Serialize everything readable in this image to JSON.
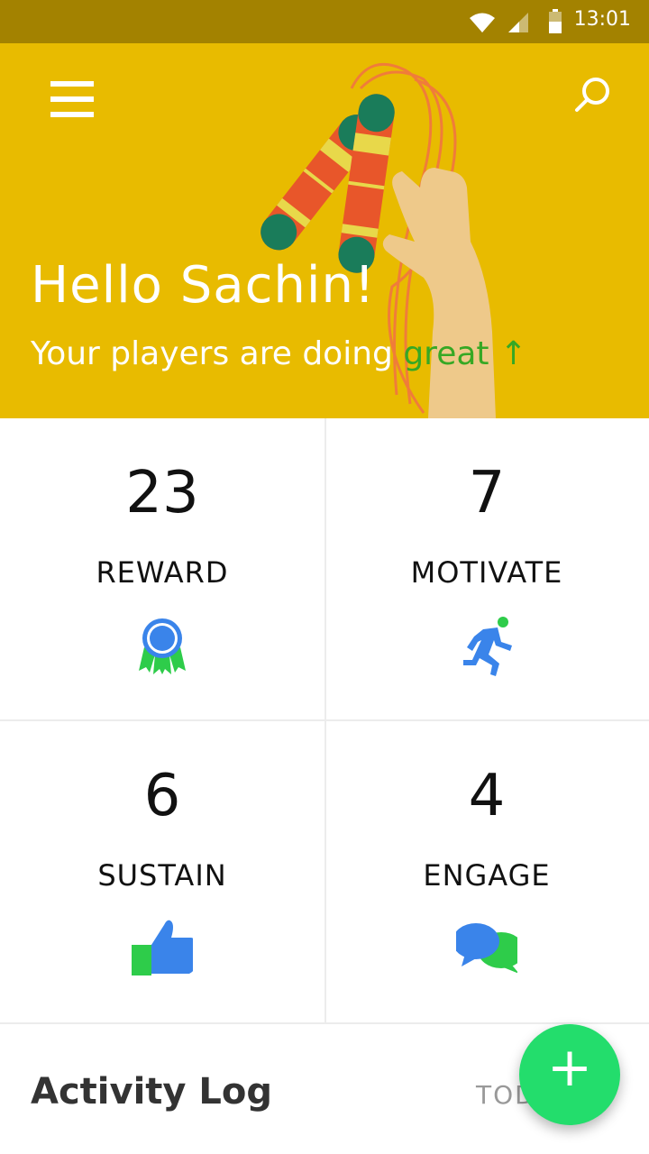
{
  "status_bar": {
    "time": "13:01",
    "icons": [
      "wifi-icon",
      "cell-signal-icon",
      "battery-icon"
    ]
  },
  "header": {
    "greeting": "Hello Sachin!",
    "subtitle_prefix": "Your players are doing ",
    "subtitle_highlight": "great",
    "trend_arrow": "↑",
    "menu_icon": "hamburger-menu-icon",
    "search_icon": "search-icon"
  },
  "stats": [
    {
      "count": "23",
      "label": "REWARD",
      "icon": "ribbon-badge-icon"
    },
    {
      "count": "7",
      "label": "MOTIVATE",
      "icon": "running-person-icon"
    },
    {
      "count": "6",
      "label": "SUSTAIN",
      "icon": "thumbs-up-icon"
    },
    {
      "count": "4",
      "label": "ENGAGE",
      "icon": "chat-bubbles-icon"
    }
  ],
  "activity": {
    "title": "Activity Log",
    "filter": "TOD"
  },
  "fab": {
    "symbol": "+",
    "icon": "plus-icon"
  },
  "colors": {
    "status_bar": "#a38200",
    "hero_background": "#e8bb00",
    "highlight_green": "#36a824",
    "fab_green": "#23dd6c",
    "icon_blue": "#3a84ea",
    "icon_green": "#2ecc4a"
  }
}
